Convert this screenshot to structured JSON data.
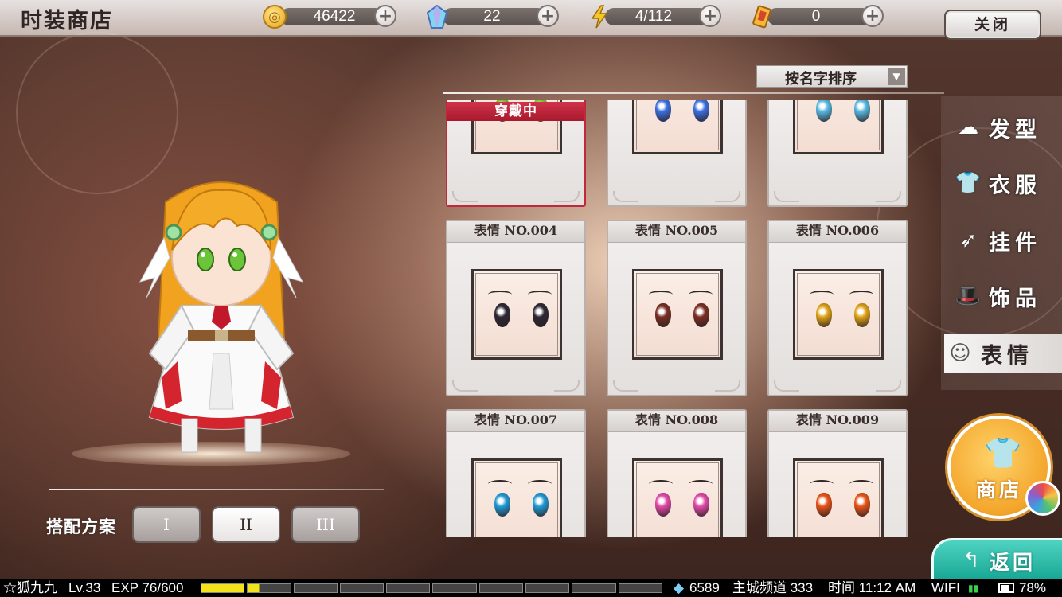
{
  "header": {
    "title": "时装商店",
    "close_label": "关闭"
  },
  "resources": [
    {
      "icon": "gold-coin-icon",
      "value": "46422"
    },
    {
      "icon": "crystal-icon",
      "value": "22"
    },
    {
      "icon": "lightning-icon",
      "value": "4/112"
    },
    {
      "icon": "ticket-icon",
      "value": "0"
    }
  ],
  "sort": {
    "label": "按名字排序"
  },
  "grid": {
    "equipped_label": "穿戴中",
    "cards": [
      {
        "title": "",
        "eye_color": "#7cc83a",
        "equipped": true,
        "row": 0,
        "col": 0,
        "partial": true
      },
      {
        "title": "",
        "eye_color": "#3b6fe0",
        "equipped": false,
        "row": 0,
        "col": 1,
        "partial": true
      },
      {
        "title": "",
        "eye_color": "#57b8e0",
        "equipped": false,
        "row": 0,
        "col": 2,
        "partial": true
      },
      {
        "title": "表情 NO.004",
        "eye_color": "#2c2733",
        "equipped": false,
        "row": 1,
        "col": 0
      },
      {
        "title": "表情 NO.005",
        "eye_color": "#7a2f22",
        "equipped": false,
        "row": 1,
        "col": 1
      },
      {
        "title": "表情 NO.006",
        "eye_color": "#e0a418",
        "equipped": false,
        "row": 1,
        "col": 2
      },
      {
        "title": "表情 NO.007",
        "eye_color": "#1f9ad6",
        "equipped": false,
        "row": 2,
        "col": 0
      },
      {
        "title": "表情 NO.008",
        "eye_color": "#e24aa8",
        "equipped": false,
        "row": 2,
        "col": 1
      },
      {
        "title": "表情 NO.009",
        "eye_color": "#e85418",
        "equipped": false,
        "row": 2,
        "col": 2
      }
    ]
  },
  "categories": [
    {
      "label": "发型",
      "icon": "hair-icon",
      "active": false
    },
    {
      "label": "衣服",
      "icon": "clothes-icon",
      "active": false
    },
    {
      "label": "挂件",
      "icon": "wing-icon",
      "active": false
    },
    {
      "label": "饰品",
      "icon": "hat-icon",
      "active": false
    },
    {
      "label": "表情",
      "icon": "face-icon",
      "active": true
    }
  ],
  "plan": {
    "label": "搭配方案",
    "options": [
      "I",
      "II",
      "III"
    ],
    "selected": "II"
  },
  "shop_button": {
    "label": "商店"
  },
  "back_button": {
    "label": "返回"
  },
  "status": {
    "player": "☆狐九九",
    "level": "Lv.33",
    "exp": "EXP 76/600",
    "exp_fraction": 0.127,
    "crystals": "6589",
    "channel": "主城频道 333",
    "time": "时间 11:12 AM",
    "network": "WIFI",
    "battery": "78%",
    "battery_level": 0.78
  },
  "colors": {
    "equipped_banner": "#c0293c",
    "shop_orange": "#f3a52a",
    "back_teal": "#18a895"
  }
}
